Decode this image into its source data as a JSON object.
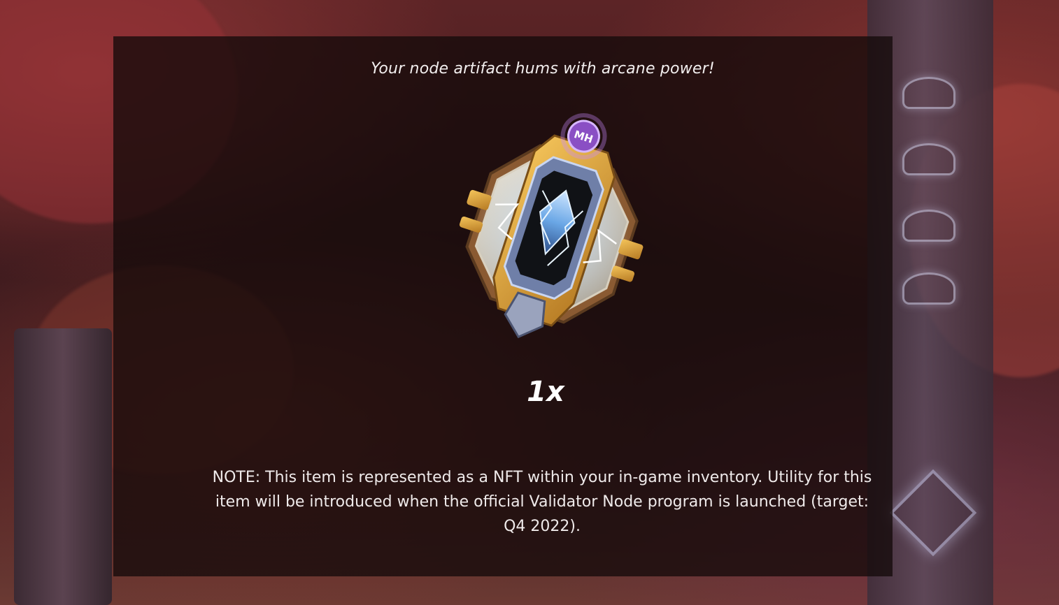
{
  "dialog": {
    "headline": "Your node artifact hums with arcane power!",
    "item": {
      "icon": "node-artifact-icon",
      "badge_text": "MH",
      "quantity": "1x"
    },
    "note": "NOTE: This item is represented as a NFT within your in-game inventory. Utility for this item will be introduced when the official Validator Node program is launched (target: Q4 2022)."
  },
  "colors": {
    "overlay": "#140a0a",
    "text": "#efeaea",
    "gold": "#e3a93a",
    "crystal": "#8fc6ff",
    "badge": "#8a4fc4"
  }
}
